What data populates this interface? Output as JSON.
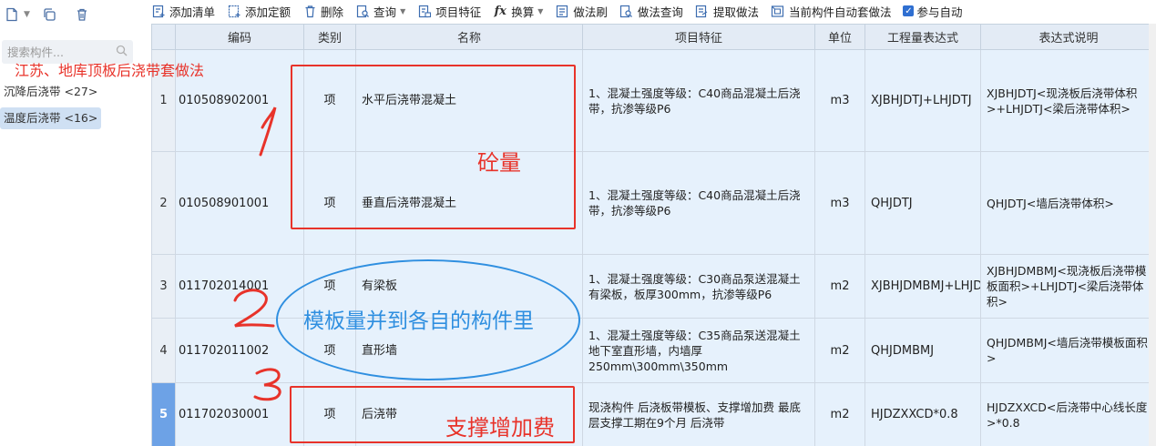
{
  "left_panel": {
    "search_placeholder": "搜索构件...",
    "items": [
      {
        "label": "沉降后浇带 <27>",
        "selected": false
      },
      {
        "label": "温度后浇带 <16>",
        "selected": true
      }
    ]
  },
  "toolbar": {
    "add_list": "添加清单",
    "add_quota": "添加定额",
    "delete": "删除",
    "query": "查询",
    "item_feature": "项目特征",
    "convert": "换算",
    "method_brush": "做法刷",
    "method_query": "做法查询",
    "extract_method": "提取做法",
    "auto_apply": "当前构件自动套做法",
    "participate": "参与自动"
  },
  "grid": {
    "headers": [
      "编码",
      "类别",
      "名称",
      "项目特征",
      "单位",
      "工程量表达式",
      "表达式说明"
    ],
    "rows": [
      {
        "num": "1",
        "code": "010508902001",
        "type": "项",
        "name": "水平后浇带混凝土",
        "feature": "1、混凝土强度等级：C40商品混凝土后浇带，抗渗等级P6",
        "unit": "m3",
        "expr": "XJBHJDTJ+LHJDTJ",
        "desc": "XJBHJDTJ<现浇板后浇带体积>+LHJDTJ<梁后浇带体积>"
      },
      {
        "num": "2",
        "code": "010508901001",
        "type": "项",
        "name": "垂直后浇带混凝土",
        "feature": "1、混凝土强度等级：C40商品混凝土后浇带，抗渗等级P6",
        "unit": "m3",
        "expr": "QHJDTJ",
        "desc": "QHJDTJ<墙后浇带体积>"
      },
      {
        "num": "3",
        "code": "011702014001",
        "type": "项",
        "name": "有梁板",
        "feature": "1、混凝土强度等级：C30商品泵送混凝土有梁板，板厚300mm，抗渗等级P6",
        "unit": "m2",
        "expr": "XJBHJDMBMJ+LHJDTJ",
        "desc": "XJBHJDMBMJ<现浇板后浇带模板面积>+LHJDTJ<梁后浇带体积>"
      },
      {
        "num": "4",
        "code": "011702011002",
        "type": "项",
        "name": "直形墙",
        "feature": "1、混凝土强度等级：C35商品泵送混凝土地下室直形墙，内墙厚250mm\\300mm\\350mm",
        "unit": "m2",
        "expr": "QHJDMBMJ",
        "desc": "QHJDMBMJ<墙后浇带模板面积>"
      },
      {
        "num": "5",
        "code": "011702030001",
        "type": "项",
        "name": "后浇带",
        "feature": "现浇构件 后浇板带模板、支撑增加费 最底层支撑工期在9个月 后浇带",
        "unit": "m2",
        "expr": "HJDZXXCD*0.8",
        "desc": "HJDZXXCD<后浇带中心线长度>*0.8"
      }
    ]
  },
  "annotations": {
    "title": "江苏、地库顶板后浇带套做法",
    "concrete_label": "砼量",
    "formwork_label": "模板量并到各自的构件里",
    "support_label": "支撑增加费",
    "mark_1": "1",
    "mark_2": "2",
    "mark_3": "3"
  },
  "colors": {
    "annotation_red": "#e8332a",
    "annotation_blue": "#2f8fe0",
    "row_fill": "#e6f1fc",
    "active_row_number": "#6da2e6"
  }
}
